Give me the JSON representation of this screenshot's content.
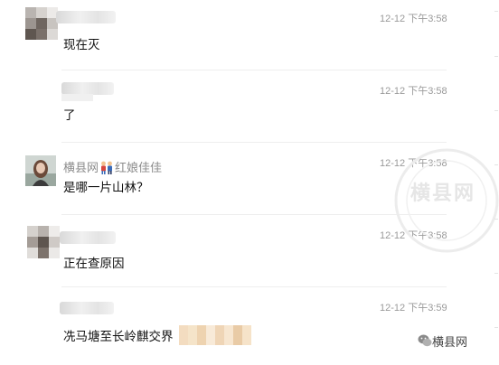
{
  "comments": [
    {
      "time": "12-12 下午3:58",
      "text": "现在灭"
    },
    {
      "time": "12-12 下午3:58",
      "text": "了"
    },
    {
      "time": "12-12 下午3:58",
      "text": "是哪一片山林？",
      "name_prefix": "横县网",
      "name_suffix": "红娘佳佳"
    },
    {
      "time": "12-12 下午3:58",
      "text": "正在查原因"
    },
    {
      "time": "12-12 下午3:59",
      "text": "冼马塘至长岭麒交界"
    }
  ],
  "watermark": {
    "seal_text": "横县网",
    "brand": "横县网"
  },
  "colors": {
    "time": "#9a9a9a",
    "name": "#8c8c8c",
    "divider": "#eeeeee"
  }
}
